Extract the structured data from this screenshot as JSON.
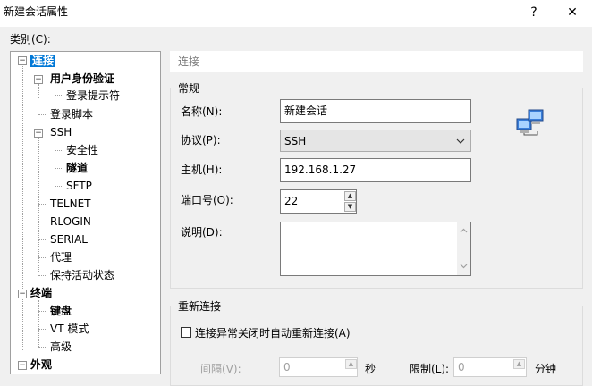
{
  "window": {
    "title": "新建会话属性",
    "help_label": "?",
    "close_label": "✕"
  },
  "category_label": "类别(C):",
  "tree": {
    "connection": "连接",
    "user_auth": "用户身份验证",
    "login_prompts": "登录提示符",
    "login_scripts": "登录脚本",
    "ssh": "SSH",
    "security": "安全性",
    "tunnel": "隧道",
    "sftp": "SFTP",
    "telnet": "TELNET",
    "rlogin": "RLOGIN",
    "serial": "SERIAL",
    "proxy": "代理",
    "keepalive": "保持活动状态",
    "terminal": "终端",
    "keyboard": "键盘",
    "vt_mode": "VT 模式",
    "advanced": "高级",
    "appearance": "外观"
  },
  "panel": {
    "header": "连接",
    "general": {
      "title": "常规",
      "name_label": "名称(N):",
      "name_value": "新建会话",
      "protocol_label": "协议(P):",
      "protocol_value": "SSH",
      "host_label": "主机(H):",
      "host_value": "192.168.1.27",
      "port_label": "端口号(O):",
      "port_value": "22",
      "desc_label": "说明(D):",
      "desc_value": ""
    },
    "reconnect": {
      "title": "重新连接",
      "auto_label": "连接异常关闭时自动重新连接(A)",
      "interval_label": "间隔(V):",
      "interval_value": "0",
      "sec_unit": "秒",
      "limit_label": "限制(L):",
      "limit_value": "0",
      "min_unit": "分钟"
    }
  }
}
